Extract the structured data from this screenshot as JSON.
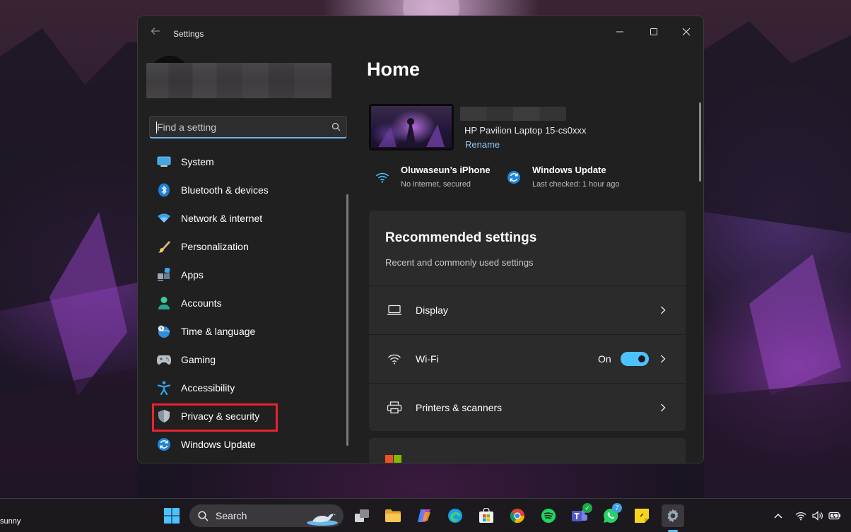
{
  "window": {
    "title": "Settings"
  },
  "sidebar": {
    "search_placeholder": "Find a setting",
    "items": [
      {
        "label": "System",
        "icon": "system-icon"
      },
      {
        "label": "Bluetooth & devices",
        "icon": "bluetooth-icon"
      },
      {
        "label": "Network & internet",
        "icon": "network-icon"
      },
      {
        "label": "Personalization",
        "icon": "brush-icon"
      },
      {
        "label": "Apps",
        "icon": "apps-icon"
      },
      {
        "label": "Accounts",
        "icon": "account-icon"
      },
      {
        "label": "Time & language",
        "icon": "globe-clock-icon"
      },
      {
        "label": "Gaming",
        "icon": "gamepad-icon"
      },
      {
        "label": "Accessibility",
        "icon": "accessibility-icon"
      },
      {
        "label": "Privacy & security",
        "icon": "shield-icon",
        "highlighted": true
      },
      {
        "label": "Windows Update",
        "icon": "update-icon"
      }
    ]
  },
  "home": {
    "title": "Home",
    "device": {
      "model": "HP Pavilion Laptop 15-cs0xxx",
      "rename_label": "Rename"
    },
    "status": [
      {
        "title": "Oluwaseun’s iPhone",
        "subtitle": "No internet, secured",
        "icon": "wifi-icon"
      },
      {
        "title": "Windows Update",
        "subtitle": "Last checked: 1 hour ago",
        "icon": "update-icon"
      }
    ],
    "recommended": {
      "title": "Recommended settings",
      "subtitle": "Recent and commonly used settings",
      "rows": [
        {
          "label": "Display",
          "icon": "laptop-icon"
        },
        {
          "label": "Wi-Fi",
          "icon": "wifi-icon",
          "toggle_label": "On",
          "toggle_on": true
        },
        {
          "label": "Printers & scanners",
          "icon": "printer-icon"
        }
      ]
    }
  },
  "taskbar": {
    "weather_text": "sunny",
    "search_label": "Search",
    "teams_badge": "7"
  },
  "colors": {
    "accent": "#4cc2ff",
    "link": "#8ec8f6",
    "highlight": "#e8232f",
    "window_bg": "#202020",
    "card_bg": "#2b2b2b"
  }
}
